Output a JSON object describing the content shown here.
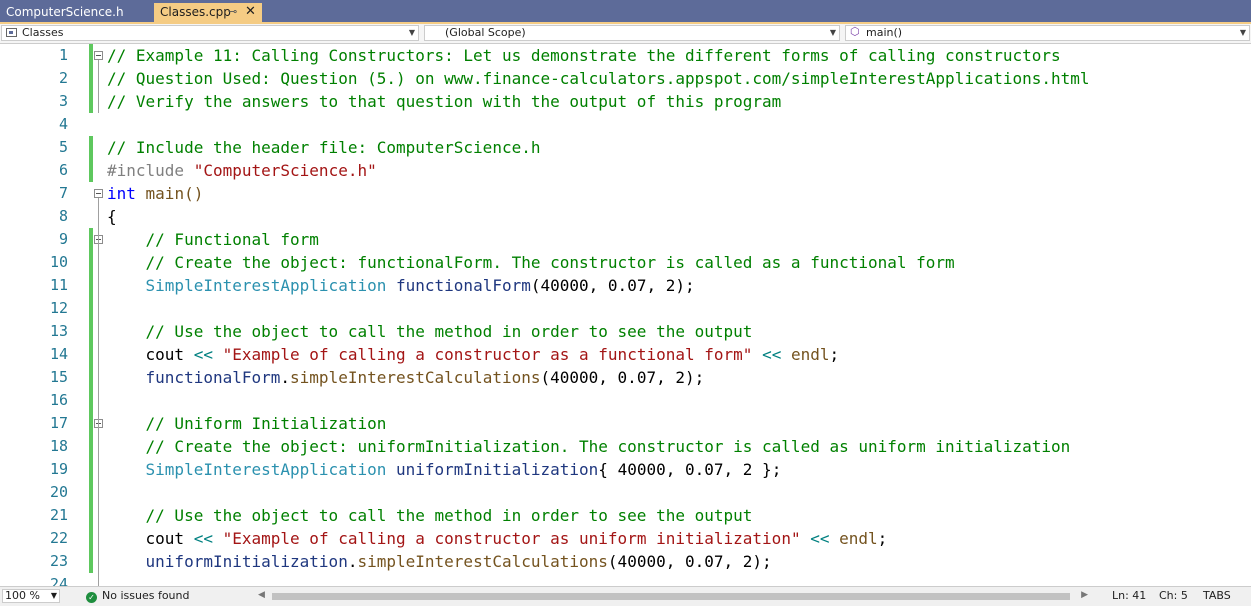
{
  "tabs": [
    {
      "label": "ComputerScience.h",
      "active": false
    },
    {
      "label": "Classes.cpp",
      "active": true,
      "pin_icon": "pin-icon",
      "close_icon": "close-icon"
    }
  ],
  "navbar": {
    "project": "Classes",
    "scope": "(Global Scope)",
    "member": "main()"
  },
  "editor": {
    "lines": [
      {
        "n": "1",
        "tokens": [
          {
            "t": "// Example 11: Calling Constructors: Let us demonstrate the different forms of calling constructors",
            "c": "c-com"
          }
        ]
      },
      {
        "n": "2",
        "tokens": [
          {
            "t": "// Question Used: Question (5.) on www.finance-calculators.appspot.com/simpleInterestApplications.html",
            "c": "c-com"
          }
        ]
      },
      {
        "n": "3",
        "tokens": [
          {
            "t": "// Verify the answers to that question with the output of this program",
            "c": "c-com"
          }
        ]
      },
      {
        "n": "4",
        "tokens": []
      },
      {
        "n": "5",
        "tokens": [
          {
            "t": "// Include the header file: ComputerScience.h",
            "c": "c-com"
          }
        ]
      },
      {
        "n": "6",
        "tokens": [
          {
            "t": "#include ",
            "c": "c-pp"
          },
          {
            "t": "\"ComputerScience.h\"",
            "c": "c-str"
          }
        ]
      },
      {
        "n": "7",
        "tokens": [
          {
            "t": "int",
            "c": "c-kw"
          },
          {
            "t": " main()",
            "c": "c-fn"
          }
        ]
      },
      {
        "n": "8",
        "tokens": [
          {
            "t": "{",
            "c": ""
          }
        ]
      },
      {
        "n": "9",
        "tokens": [
          {
            "t": "    // Functional form",
            "c": "c-com"
          }
        ]
      },
      {
        "n": "10",
        "tokens": [
          {
            "t": "    // Create the object: functionalForm. The constructor is called as a functional form",
            "c": "c-com"
          }
        ]
      },
      {
        "n": "11",
        "tokens": [
          {
            "t": "    ",
            "c": ""
          },
          {
            "t": "SimpleInterestApplication",
            "c": "c-type"
          },
          {
            "t": " ",
            "c": ""
          },
          {
            "t": "functionalForm",
            "c": "c-var"
          },
          {
            "t": "(40000, 0.07, 2);",
            "c": ""
          }
        ]
      },
      {
        "n": "12",
        "tokens": []
      },
      {
        "n": "13",
        "tokens": [
          {
            "t": "    // Use the object to call the method in order to see the output",
            "c": "c-com"
          }
        ]
      },
      {
        "n": "14",
        "tokens": [
          {
            "t": "    cout ",
            "c": ""
          },
          {
            "t": "<<",
            "c": "c-op"
          },
          {
            "t": " ",
            "c": ""
          },
          {
            "t": "\"Example of calling a constructor as a functional form\"",
            "c": "c-str"
          },
          {
            "t": " ",
            "c": ""
          },
          {
            "t": "<<",
            "c": "c-op"
          },
          {
            "t": " ",
            "c": ""
          },
          {
            "t": "endl",
            "c": "c-fn"
          },
          {
            "t": ";",
            "c": ""
          }
        ]
      },
      {
        "n": "15",
        "tokens": [
          {
            "t": "    ",
            "c": ""
          },
          {
            "t": "functionalForm",
            "c": "c-var"
          },
          {
            "t": ".",
            "c": ""
          },
          {
            "t": "simpleInterestCalculations",
            "c": "c-fn"
          },
          {
            "t": "(40000, 0.07, 2);",
            "c": ""
          }
        ]
      },
      {
        "n": "16",
        "tokens": []
      },
      {
        "n": "17",
        "tokens": [
          {
            "t": "    // Uniform Initialization",
            "c": "c-com"
          }
        ]
      },
      {
        "n": "18",
        "tokens": [
          {
            "t": "    // Create the object: uniformInitialization. The constructor is called as uniform initialization",
            "c": "c-com"
          }
        ]
      },
      {
        "n": "19",
        "tokens": [
          {
            "t": "    ",
            "c": ""
          },
          {
            "t": "SimpleInterestApplication",
            "c": "c-type"
          },
          {
            "t": " ",
            "c": ""
          },
          {
            "t": "uniformInitialization",
            "c": "c-var"
          },
          {
            "t": "{ 40000, 0.07, 2 };",
            "c": ""
          }
        ]
      },
      {
        "n": "20",
        "tokens": []
      },
      {
        "n": "21",
        "tokens": [
          {
            "t": "    // Use the object to call the method in order to see the output",
            "c": "c-com"
          }
        ]
      },
      {
        "n": "22",
        "tokens": [
          {
            "t": "    cout ",
            "c": ""
          },
          {
            "t": "<<",
            "c": "c-op"
          },
          {
            "t": " ",
            "c": ""
          },
          {
            "t": "\"Example of calling a constructor as uniform initialization\"",
            "c": "c-str"
          },
          {
            "t": " ",
            "c": ""
          },
          {
            "t": "<<",
            "c": "c-op"
          },
          {
            "t": " ",
            "c": ""
          },
          {
            "t": "endl",
            "c": "c-fn"
          },
          {
            "t": ";",
            "c": ""
          }
        ]
      },
      {
        "n": "23",
        "tokens": [
          {
            "t": "    ",
            "c": ""
          },
          {
            "t": "uniformInitialization",
            "c": "c-var"
          },
          {
            "t": ".",
            "c": ""
          },
          {
            "t": "simpleInterestCalculations",
            "c": "c-fn"
          },
          {
            "t": "(40000, 0.07, 2);",
            "c": ""
          }
        ]
      },
      {
        "n": "24",
        "tokens": []
      }
    ]
  },
  "status": {
    "zoom": "100 %",
    "issues": "No issues found",
    "line": "Ln: 41",
    "col": "Ch: 5",
    "indent": "TABS"
  },
  "colors": {
    "tab_strip": "#5d6b99",
    "active_tab": "#f5cc84",
    "comment": "#008000",
    "keyword": "#0000ff",
    "string": "#a31515",
    "type": "#2b91af",
    "change_bar": "#5ec85e"
  }
}
